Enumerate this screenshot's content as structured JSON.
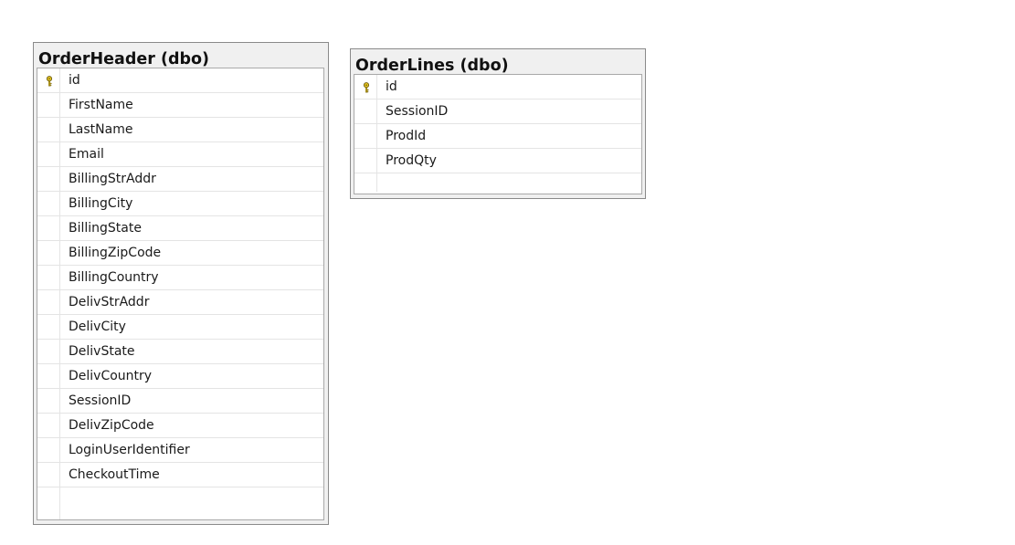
{
  "tables": [
    {
      "title": "OrderHeader (dbo)",
      "columns": [
        {
          "name": "id",
          "primary_key": true
        },
        {
          "name": "FirstName",
          "primary_key": false
        },
        {
          "name": "LastName",
          "primary_key": false
        },
        {
          "name": "Email",
          "primary_key": false
        },
        {
          "name": "BillingStrAddr",
          "primary_key": false
        },
        {
          "name": "BillingCity",
          "primary_key": false
        },
        {
          "name": "BillingState",
          "primary_key": false
        },
        {
          "name": "BillingZipCode",
          "primary_key": false
        },
        {
          "name": "BillingCountry",
          "primary_key": false
        },
        {
          "name": "DelivStrAddr",
          "primary_key": false
        },
        {
          "name": "DelivCity",
          "primary_key": false
        },
        {
          "name": "DelivState",
          "primary_key": false
        },
        {
          "name": "DelivCountry",
          "primary_key": false
        },
        {
          "name": "SessionID",
          "primary_key": false
        },
        {
          "name": "DelivZipCode",
          "primary_key": false
        },
        {
          "name": "LoginUserIdentifier",
          "primary_key": false
        },
        {
          "name": "CheckoutTime",
          "primary_key": false
        }
      ]
    },
    {
      "title": "OrderLines (dbo)",
      "columns": [
        {
          "name": "id",
          "primary_key": true
        },
        {
          "name": "SessionID",
          "primary_key": false
        },
        {
          "name": "ProdId",
          "primary_key": false
        },
        {
          "name": "ProdQty",
          "primary_key": false
        }
      ]
    }
  ],
  "colors": {
    "key_icon": "#e8c820",
    "key_icon_outline": "#6b5a10",
    "header_bg": "#f0f0f0"
  },
  "icons": {
    "primary_key": "key-icon"
  }
}
